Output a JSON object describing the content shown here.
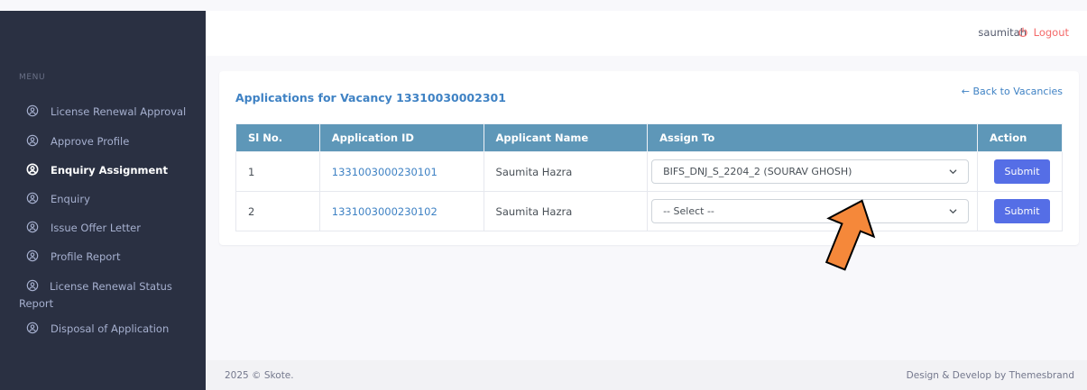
{
  "header": {
    "user_name": "saumitah",
    "logout_label": "Logout"
  },
  "sidebar": {
    "menu_title": "MENU",
    "items": [
      {
        "label": "License Renewal Approval",
        "active": false
      },
      {
        "label": "Approve Profile",
        "active": false
      },
      {
        "label": "Enquiry Assignment",
        "active": true
      },
      {
        "label": "Enquiry",
        "active": false
      },
      {
        "label": "Issue Offer Letter",
        "active": false
      },
      {
        "label": "Profile Report",
        "active": false
      },
      {
        "label": "License Renewal Status Report",
        "active": false
      },
      {
        "label": "Disposal of Application",
        "active": false
      }
    ]
  },
  "card": {
    "title": "Applications for Vacancy 13310030002301",
    "back_link": "← Back to Vacancies"
  },
  "table": {
    "headers": [
      "Sl No.",
      "Application ID",
      "Applicant Name",
      "Assign To",
      "Action"
    ],
    "rows": [
      {
        "sl": "1",
        "app_id": "1331003000230101",
        "name": "Saumita Hazra",
        "assign": "BIFS_DNJ_S_2204_2 (SOURAV GHOSH)",
        "action": "Submit"
      },
      {
        "sl": "2",
        "app_id": "1331003000230102",
        "name": "Saumita Hazra",
        "assign": "-- Select --",
        "action": "Submit"
      }
    ]
  },
  "footer": {
    "left": "2025 © Skote.",
    "right": "Design & Develop by Themesbrand"
  },
  "colors": {
    "sidebar_bg": "#2a3042",
    "table_header_bg": "#5e97b8",
    "submit_button": "#556ee6",
    "link": "#3f82c4",
    "logout": "#f46a6a",
    "annotation_arrow": "#f5883a"
  },
  "icons": {
    "nav_item": "user-circle-icon",
    "logout": "power-icon",
    "select": "chevron-down-icon",
    "annotation": "arrow-up-icon"
  }
}
